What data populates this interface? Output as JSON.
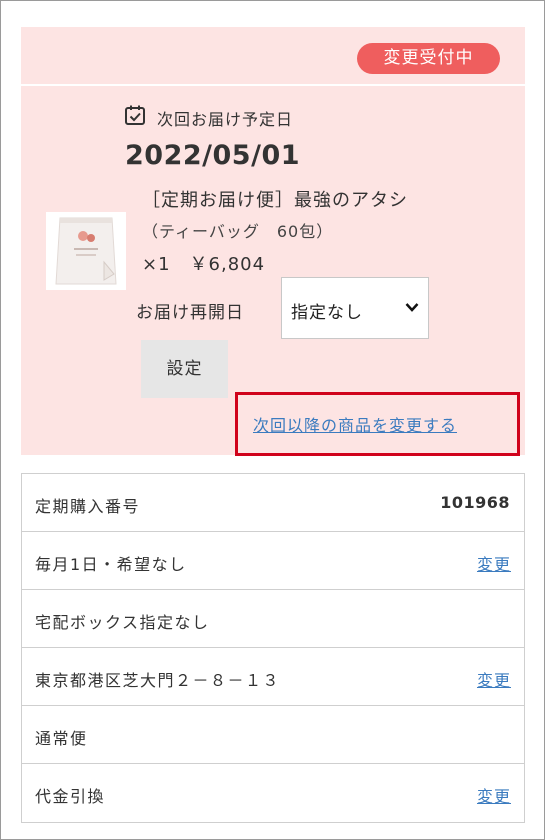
{
  "status_badge": "変更受付中",
  "next_delivery": {
    "label": "次回お届け予定日",
    "date": "2022/05/01"
  },
  "product": {
    "name": "［定期お届け便］最強のアタシ",
    "sub": "（ティーバッグ　60包）",
    "qty_price": "×1　￥6,804"
  },
  "resume": {
    "label": "お届け再開日",
    "select_value": "指定なし"
  },
  "set_button": "設定",
  "change_next_link": "次回以降の商品を変更する",
  "info_rows": [
    {
      "text": "定期購入番号",
      "value": "101968"
    },
    {
      "text": "毎月1日・希望なし",
      "link": "変更"
    },
    {
      "text": "宅配ボックス指定なし"
    },
    {
      "text": "東京都港区芝大門２－８－１３",
      "link": "変更"
    },
    {
      "text": "通常便"
    },
    {
      "text": "代金引換",
      "link": "変更"
    }
  ],
  "colors": {
    "card_background": "#fde4e3",
    "badge": "#ef5e5e",
    "link": "#3b7bbf",
    "highlight": "#d0021b"
  },
  "icons": {
    "calendar": "calendar-check-icon",
    "select": "chevron-down-icon"
  }
}
